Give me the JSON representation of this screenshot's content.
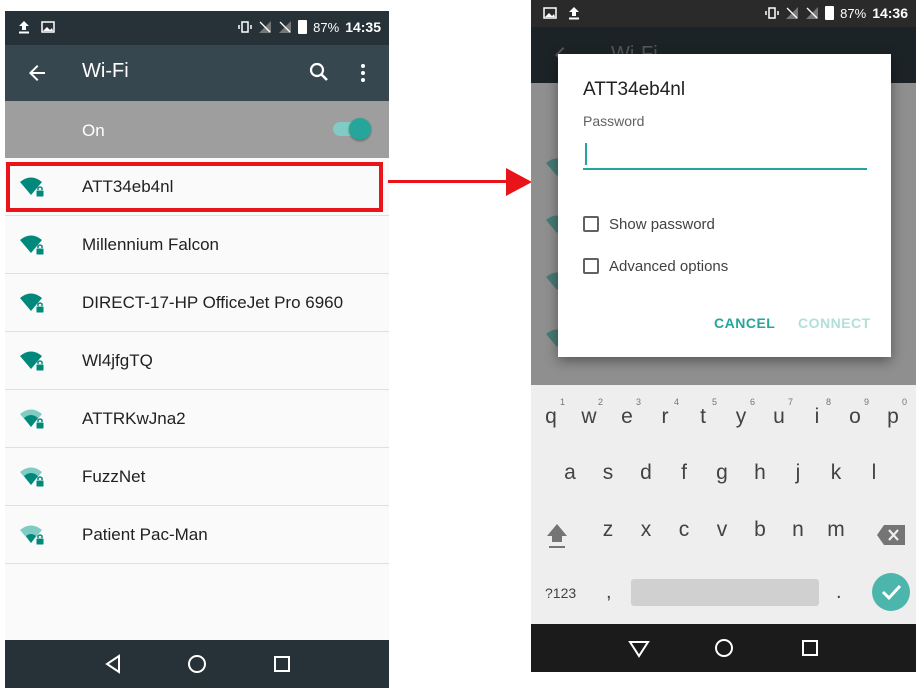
{
  "colors": {
    "accent": "#26a69a",
    "highlight": "#e8141a",
    "appbar": "#37474f",
    "statusbar": "#263238"
  },
  "left_screen": {
    "status": {
      "battery": "87%",
      "time": "14:35"
    },
    "appbar": {
      "title": "Wi-Fi",
      "back_icon": "arrow-back-icon",
      "search_icon": "search-icon",
      "more_icon": "more-vert-icon"
    },
    "wifi_toggle": {
      "label": "On",
      "state": "on"
    },
    "networks": [
      {
        "name": "ATT34eb4nl",
        "icon": "wifi-lock-icon"
      },
      {
        "name": "Millennium Falcon",
        "icon": "wifi-lock-icon"
      },
      {
        "name": "DIRECT-17-HP OfficeJet Pro 6960",
        "icon": "wifi-lock-icon"
      },
      {
        "name": "Wl4jfgTQ",
        "icon": "wifi-lock-icon"
      },
      {
        "name": "ATTRKwJna2",
        "icon": "wifi-lock-icon"
      },
      {
        "name": "FuzzNet",
        "icon": "wifi-lock-icon"
      },
      {
        "name": "Patient Pac-Man",
        "icon": "wifi-lock-icon"
      }
    ]
  },
  "right_screen": {
    "status": {
      "battery": "87%",
      "time": "14:36"
    },
    "appbar": {
      "title": "Wi-Fi"
    },
    "dialog": {
      "title": "ATT34eb4nl",
      "password_label": "Password",
      "password_value": "",
      "show_password": "Show password",
      "advanced_options": "Advanced options",
      "cancel": "CANCEL",
      "connect": "CONNECT"
    },
    "keyboard": {
      "row1": [
        {
          "k": "q",
          "h": "1"
        },
        {
          "k": "w",
          "h": "2"
        },
        {
          "k": "e",
          "h": "3"
        },
        {
          "k": "r",
          "h": "4"
        },
        {
          "k": "t",
          "h": "5"
        },
        {
          "k": "y",
          "h": "6"
        },
        {
          "k": "u",
          "h": "7"
        },
        {
          "k": "i",
          "h": "8"
        },
        {
          "k": "o",
          "h": "9"
        },
        {
          "k": "p",
          "h": "0"
        }
      ],
      "row2": [
        "a",
        "s",
        "d",
        "f",
        "g",
        "h",
        "j",
        "k",
        "l"
      ],
      "row3": [
        "z",
        "x",
        "c",
        "v",
        "b",
        "n",
        "m"
      ],
      "symbols": "?123",
      "comma": ",",
      "period": "."
    }
  }
}
